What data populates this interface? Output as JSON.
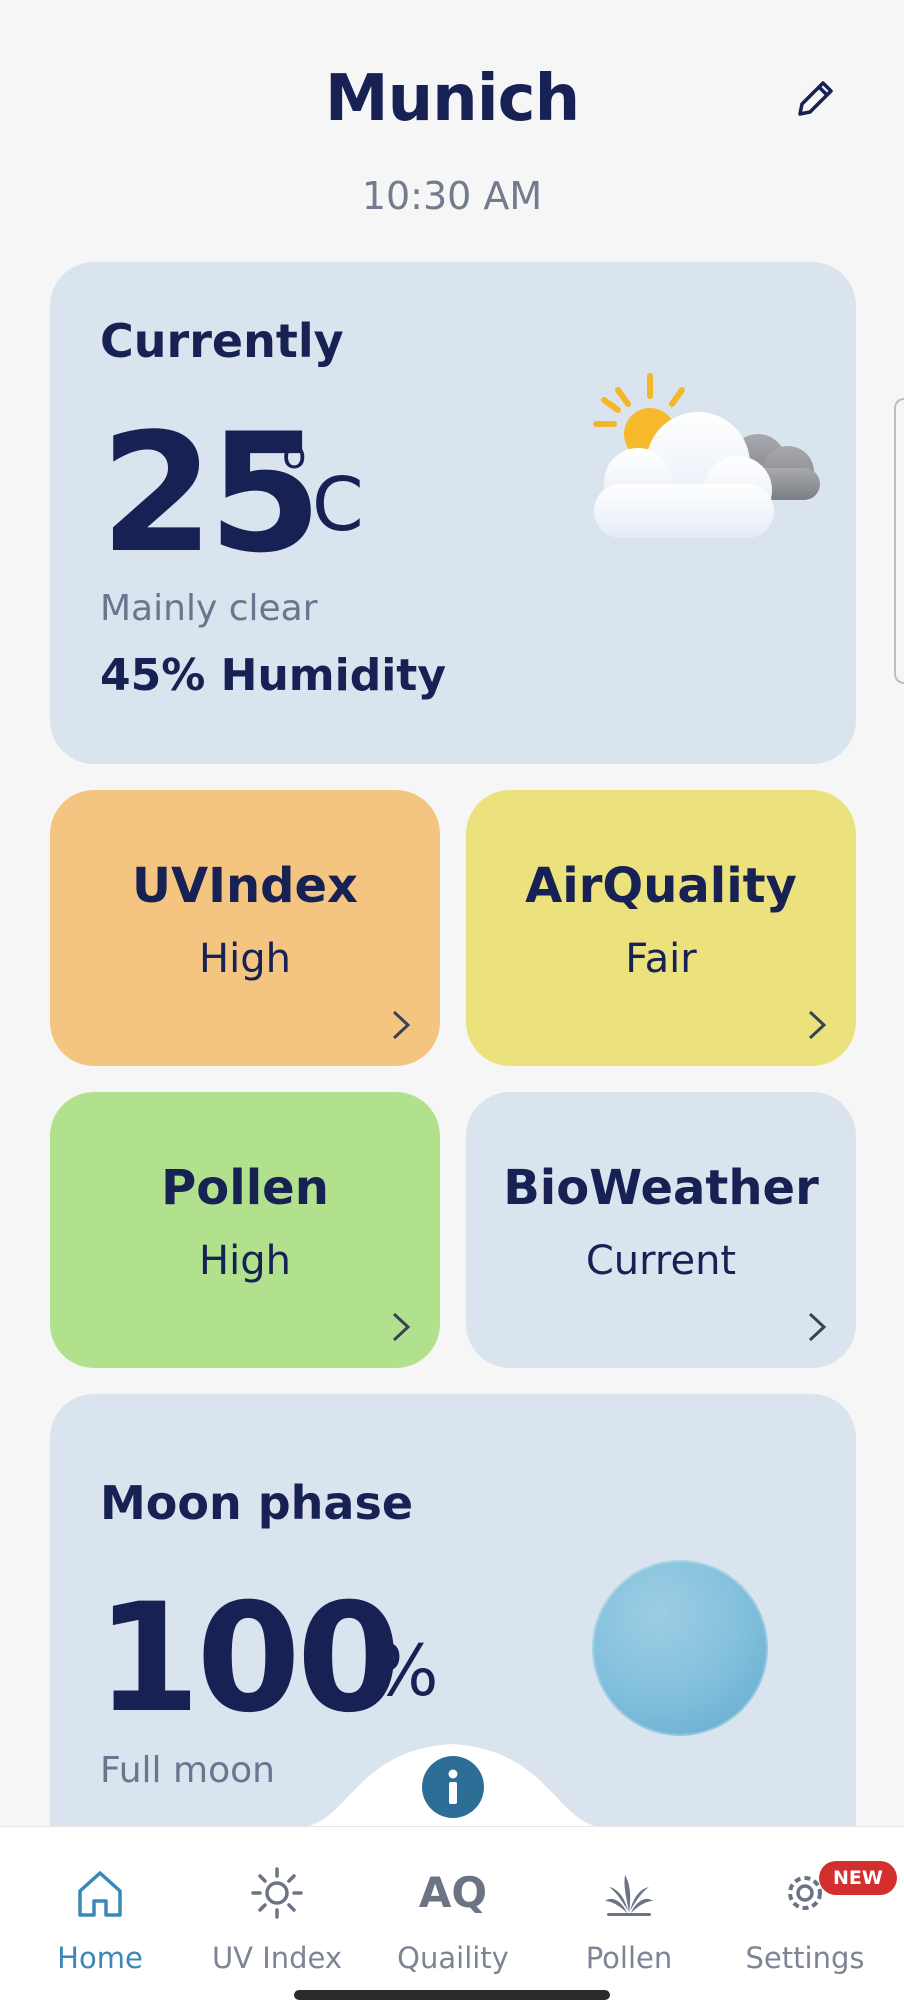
{
  "header": {
    "city": "Munich",
    "time": "10:30 AM"
  },
  "current": {
    "label": "Currently",
    "temperature": "25",
    "degree_symbol": "o",
    "unit": "C",
    "condition": "Mainly clear",
    "humidity": "45% Humidity",
    "icon": "sun-behind-clouds-icon"
  },
  "tiles": [
    {
      "title": "UVIndex",
      "value": "High",
      "color": "#f4c580"
    },
    {
      "title": "AirQuality",
      "value": "Fair",
      "color": "#ebe27e"
    },
    {
      "title": "Pollen",
      "value": "High",
      "color": "#b2e18e"
    },
    {
      "title": "BioWeather",
      "value": "Current",
      "color": "#d9e4ee"
    }
  ],
  "moon": {
    "label": "Moon phase",
    "percent": "100",
    "percent_sign": "%",
    "phase": "Full moon"
  },
  "nav": {
    "tabs": [
      {
        "label": "Home",
        "icon": "home-icon",
        "active": true
      },
      {
        "label": "UV Index",
        "icon": "sun-icon"
      },
      {
        "label": "Quaility",
        "icon": "aq-icon",
        "icon_text": "AQ"
      },
      {
        "label": "Pollen",
        "icon": "plant-icon"
      },
      {
        "label": "Settings",
        "icon": "gear-icon",
        "badge": "NEW"
      }
    ]
  },
  "colors": {
    "text": "#172154",
    "accent": "#3a88b7",
    "info_button": "#2c6e96",
    "badge": "#d32f2f"
  }
}
